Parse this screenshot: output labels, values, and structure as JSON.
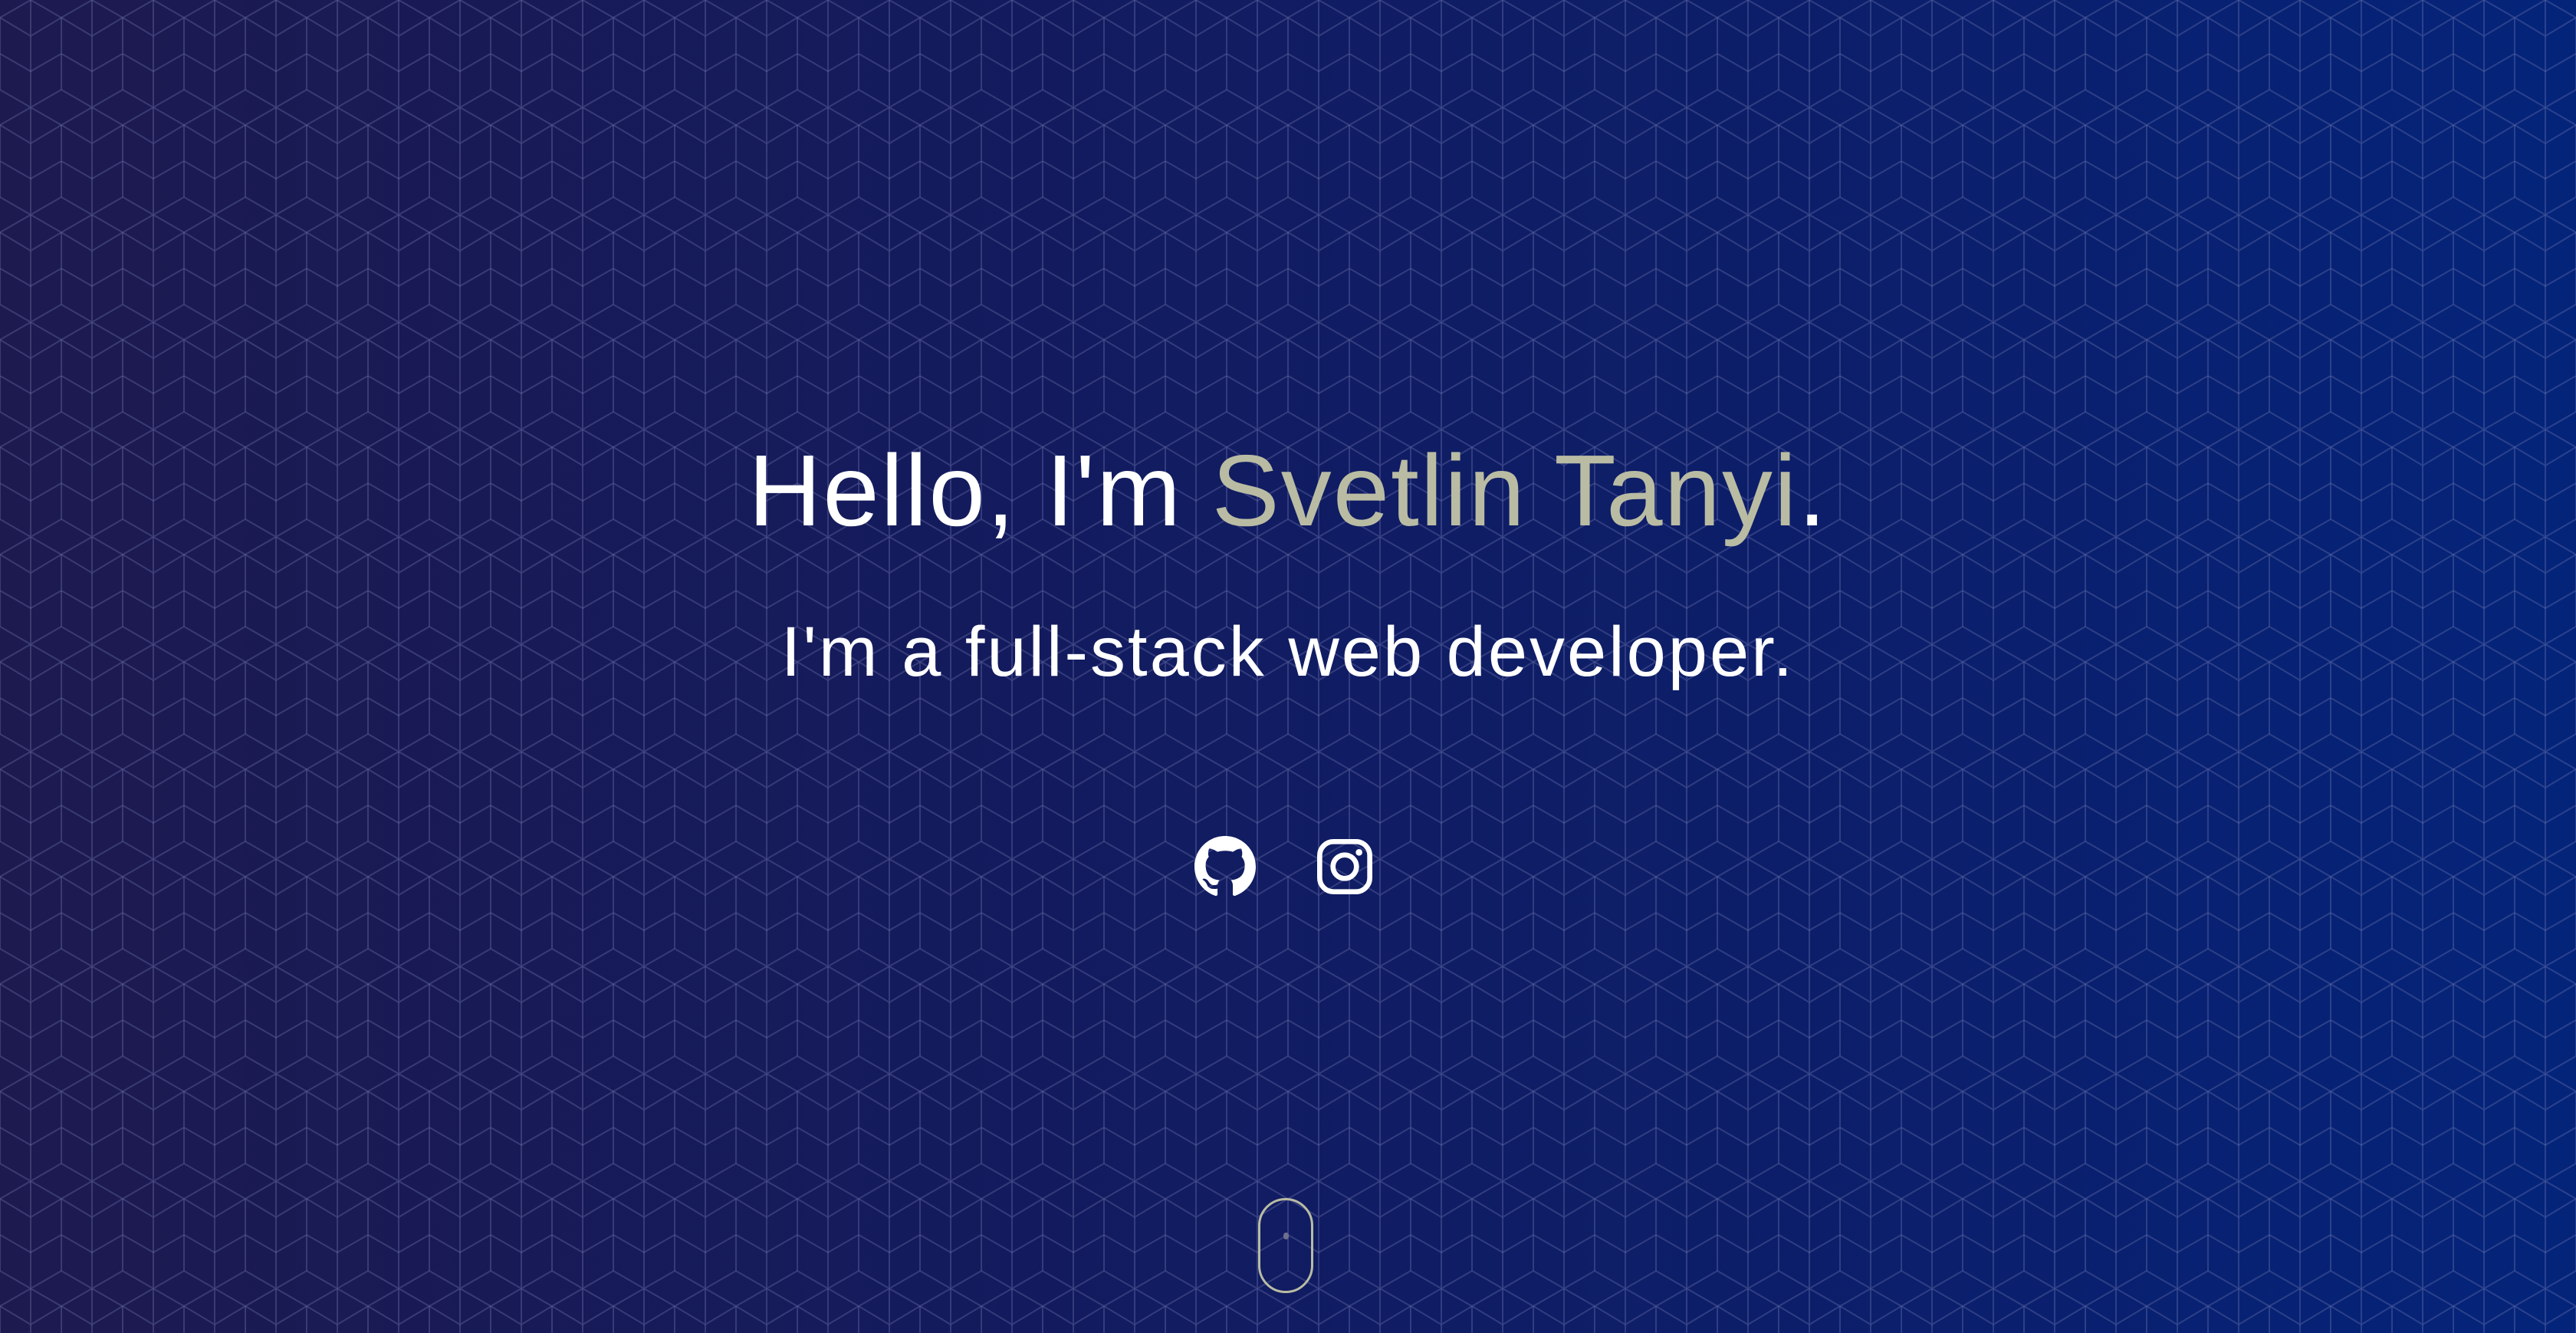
{
  "hero": {
    "greeting": "Hello, I'm ",
    "name": "Svetlin Tanyi",
    "period": ".",
    "tagline": "I'm a full-stack web developer."
  },
  "social": {
    "items": [
      {
        "icon": "github-icon",
        "link_label": "GitHub"
      },
      {
        "icon": "instagram-icon",
        "link_label": "Instagram"
      }
    ]
  },
  "colors": {
    "accent": "#b9bca3",
    "text": "#ffffff",
    "bg_left": "#1d1a4f",
    "bg_right": "#04247a",
    "pattern_line": "#5a5f9a"
  }
}
